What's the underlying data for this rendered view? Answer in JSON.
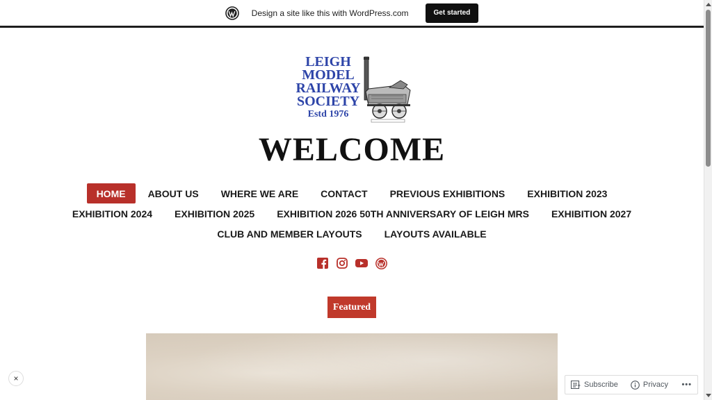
{
  "promo_bar": {
    "text": "Design a site like this with WordPress.com",
    "button_label": "Get started",
    "icon": "wordpress-icon"
  },
  "logo": {
    "line1": "LEIGH",
    "line2": "MODEL",
    "line3": "RAILWAY",
    "line4": "SOCIETY",
    "estd": "Estd 1976",
    "image": "locomotive-illustration"
  },
  "site_title": "WELCOME",
  "nav": {
    "items": [
      {
        "label": "HOME",
        "active": true
      },
      {
        "label": "ABOUT US"
      },
      {
        "label": "WHERE WE ARE"
      },
      {
        "label": "CONTACT"
      },
      {
        "label": "PREVIOUS EXHIBITIONS"
      },
      {
        "label": "EXHIBITION 2023"
      },
      {
        "label": "EXHIBITION 2024"
      },
      {
        "label": "EXHIBITION 2025"
      },
      {
        "label": "EXHIBITION 2026 50TH ANNIVERSARY OF LEIGH MRS"
      },
      {
        "label": "EXHIBITION 2027"
      },
      {
        "label": "CLUB AND MEMBER LAYOUTS"
      },
      {
        "label": "LAYOUTS AVAILABLE"
      }
    ]
  },
  "social": {
    "icons": [
      "facebook-icon",
      "instagram-icon",
      "youtube-icon",
      "wordpress-icon"
    ]
  },
  "featured_label": "Featured",
  "actionbar": {
    "subscribe": "Subscribe",
    "privacy": "Privacy",
    "more": "•••"
  },
  "close_symbol": "×",
  "colors": {
    "accent": "#b8302a",
    "logo_blue": "#2d44a8",
    "promo_button": "#101010"
  }
}
